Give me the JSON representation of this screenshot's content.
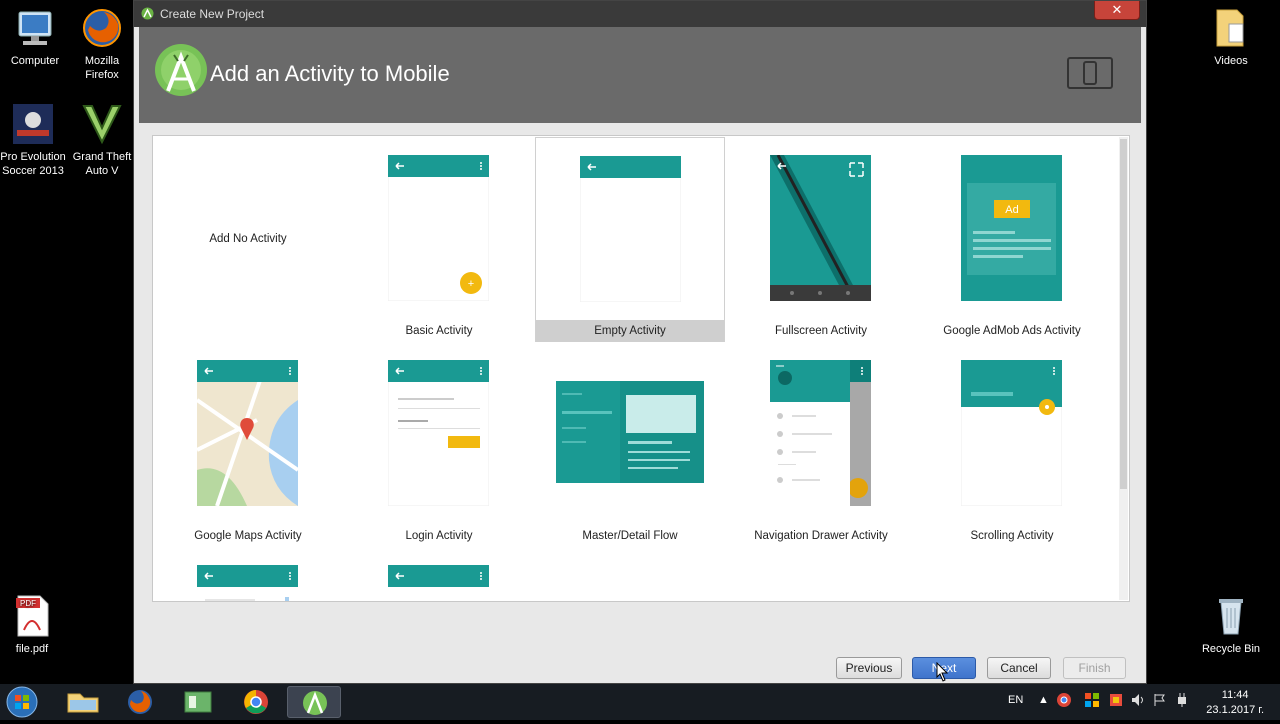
{
  "desktop": {
    "icons": [
      {
        "name": "computer",
        "label_lines": [
          "Computer"
        ]
      },
      {
        "name": "firefox",
        "label_lines": [
          "Mozilla",
          "Firefox"
        ]
      },
      {
        "name": "pes",
        "label_lines": [
          "Pro Evolution",
          "Soccer 2013"
        ]
      },
      {
        "name": "gta",
        "label_lines": [
          "Grand Theft",
          "Auto V"
        ]
      },
      {
        "name": "videos",
        "label_lines": [
          "Videos"
        ]
      },
      {
        "name": "pdf",
        "label_lines": [
          "file.pdf"
        ],
        "badge": "PDF"
      },
      {
        "name": "recycle",
        "label_lines": [
          "Recycle Bin"
        ]
      }
    ]
  },
  "window": {
    "title": "Create New Project",
    "close_glyph": "✕",
    "heading": "Add an Activity to Mobile"
  },
  "gallery": {
    "items": [
      {
        "label": "Add No Activity",
        "kind": "none"
      },
      {
        "label": "Basic Activity",
        "kind": "basic"
      },
      {
        "label": "Empty Activity",
        "kind": "empty",
        "selected": true
      },
      {
        "label": "Fullscreen Activity",
        "kind": "fullscreen"
      },
      {
        "label": "Google AdMob Ads Activity",
        "kind": "admob",
        "ad_text": "Ad"
      },
      {
        "label": "Google Maps Activity",
        "kind": "maps"
      },
      {
        "label": "Login Activity",
        "kind": "login"
      },
      {
        "label": "Master/Detail Flow",
        "kind": "master"
      },
      {
        "label": "Navigation Drawer Activity",
        "kind": "navdrawer"
      },
      {
        "label": "Scrolling Activity",
        "kind": "scrolling"
      }
    ]
  },
  "buttons": {
    "previous": "Previous",
    "next": "Next",
    "cancel": "Cancel",
    "finish": "Finish"
  },
  "taskbar": {
    "language": "EN",
    "time": "11:44",
    "date": "23.1.2017 г."
  },
  "colors": {
    "teal": "#1a9a93",
    "teal_dark": "#0e7f79",
    "fab": "#f2b90f",
    "header_bg": "#6a6a6a"
  }
}
